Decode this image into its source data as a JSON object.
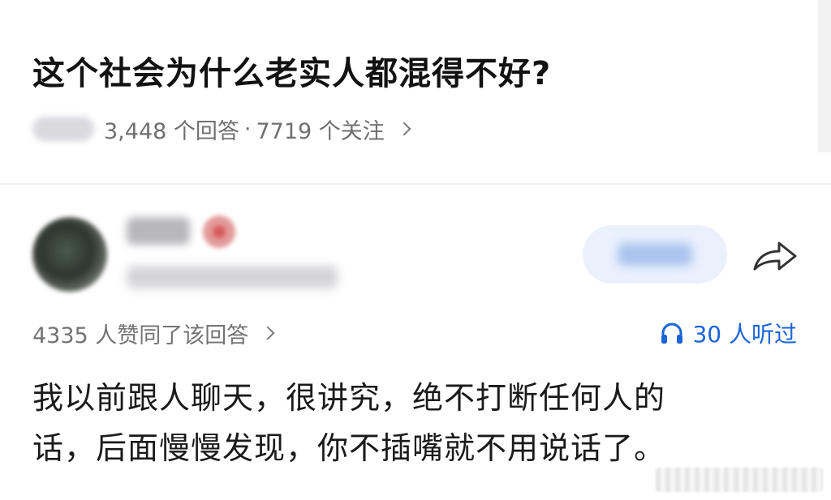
{
  "question": {
    "title": "这个社会为什么老实人都混得不好?",
    "answer_count": "3,448 个回答",
    "separator": "·",
    "follower_count": "7719 个关注"
  },
  "author": {
    "icons": {
      "badge": "verified-badge-icon",
      "follow": "plus-icon",
      "share": "share-arrow-icon"
    }
  },
  "stats": {
    "votes": "4335 人赞同了该回答",
    "listens": "30 人听过",
    "listens_color": "#1a64d8"
  },
  "answer": {
    "lines": [
      "我以前跟人聊天，很讲究，绝不打断任何人的",
      "话，后面慢慢发现，你不插嘴就不用说话了。"
    ]
  }
}
